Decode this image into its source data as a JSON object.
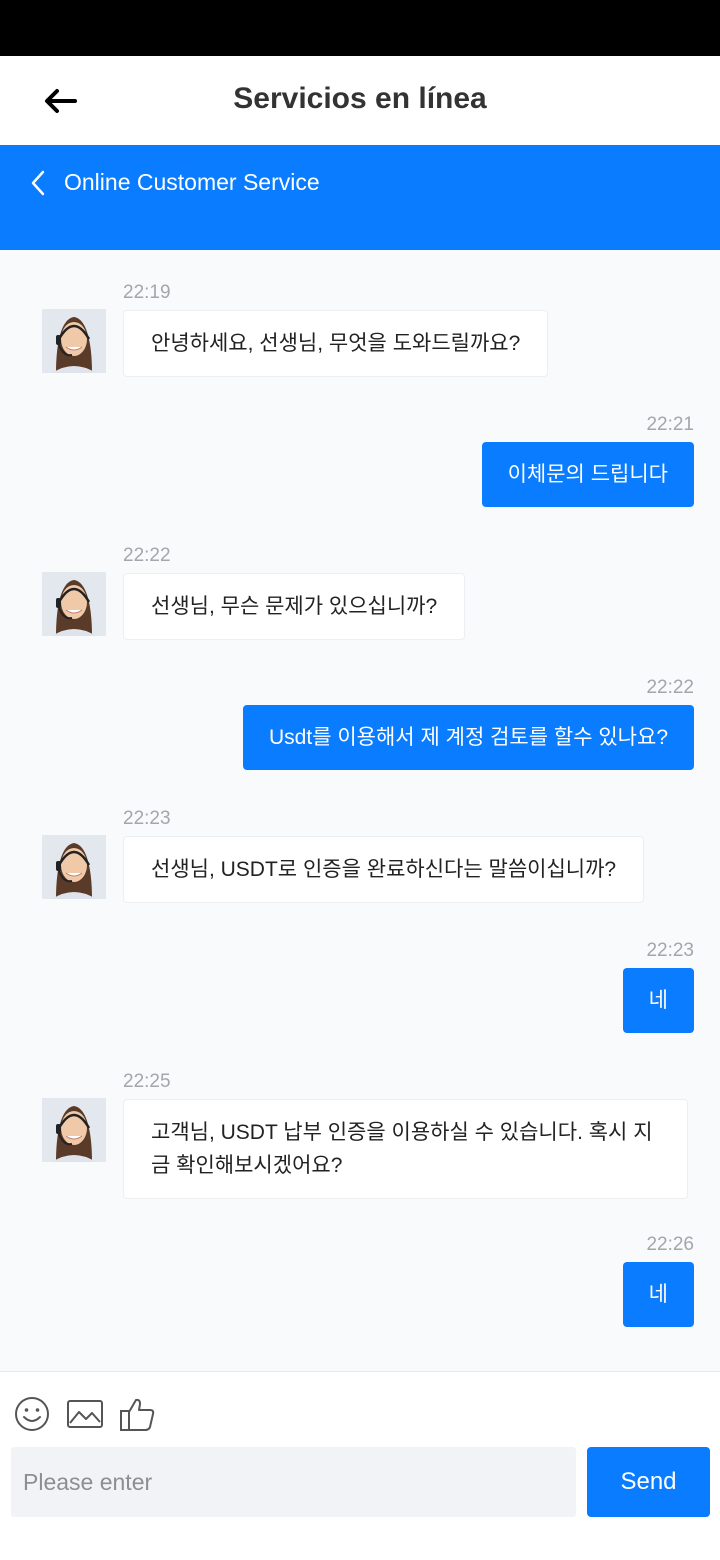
{
  "header": {
    "title": "Servicios en línea"
  },
  "cs_bar": {
    "title": "Online Customer Service"
  },
  "messages": [
    {
      "from": "agent",
      "time": "22:19",
      "text": "안녕하세요, 선생님, 무엇을 도와드릴까요?"
    },
    {
      "from": "user",
      "time": "22:21",
      "text": "이체문의 드립니다"
    },
    {
      "from": "agent",
      "time": "22:22",
      "text": "선생님, 무슨 문제가 있으십니까?"
    },
    {
      "from": "user",
      "time": "22:22",
      "text": "Usdt를 이용해서 제 계정 검토를 할수 있나요?"
    },
    {
      "from": "agent",
      "time": "22:23",
      "text": "선생님, USDT로 인증을 완료하신다는 말씀이십니까?"
    },
    {
      "from": "user",
      "time": "22:23",
      "text": "네"
    },
    {
      "from": "agent",
      "time": "22:25",
      "text": "고객님, USDT 납부 인증을 이용하실 수 있습니다. 혹시 지금 확인해보시겠어요?"
    },
    {
      "from": "user",
      "time": "22:26",
      "text": "네"
    }
  ],
  "composer": {
    "placeholder": "Please enter",
    "send_label": "Send",
    "icons": [
      "smiley-icon",
      "image-icon",
      "thumbs-up-icon"
    ]
  },
  "colors": {
    "accent": "#0a7cff",
    "chat_bg": "#f9fafb"
  }
}
